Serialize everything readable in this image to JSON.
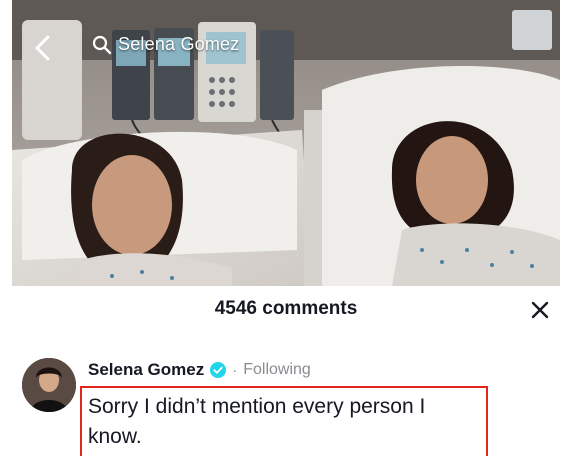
{
  "top_bar": {
    "search_query": "Selena Gomez",
    "back_icon": "chevron-left-icon",
    "search_icon": "search-icon"
  },
  "comments_sheet": {
    "title": "4546 comments",
    "close_icon": "close-icon"
  },
  "comment": {
    "username": "Selena Gomez",
    "verified_icon": "verified-badge-icon",
    "separator": "·",
    "follow_status": "Following",
    "text": "Sorry I didn’t mention every person I know."
  },
  "colors": {
    "highlight_border": "#e2261d",
    "verified_blue": "#20d5ec",
    "text_primary": "#161823",
    "text_secondary": "#8a8b91"
  }
}
